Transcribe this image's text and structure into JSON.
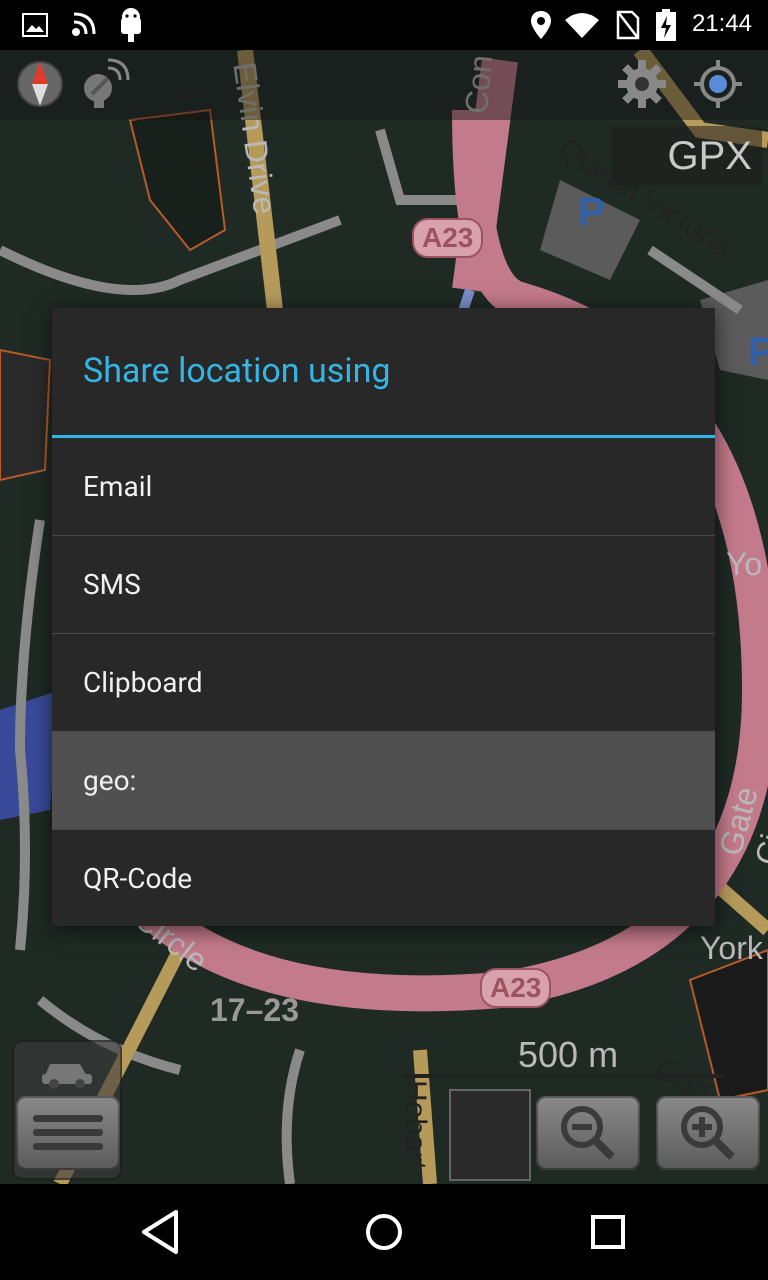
{
  "status_bar": {
    "time": "21:44",
    "icons": [
      "image-icon",
      "signal-wave-icon",
      "android-icon",
      "location-pin-icon",
      "wifi-icon",
      "no-sim-icon",
      "battery-charging-icon"
    ]
  },
  "map": {
    "labels": {
      "elvin_drive": "Elvin Drive",
      "queen_victoria": "Queen Victoria",
      "a23_top": "A23",
      "a23_bottom": "A23",
      "con": "Con",
      "york_1": "Yo",
      "york_2": "York",
      "gate_circle": "Gate Circle",
      "hobart": "Hobart",
      "cant": "Can",
      "circle": "Circle",
      "num": "17–23",
      "parking_1": "P",
      "parking_2": "P"
    },
    "scale": "500 m",
    "gpx_label": "GPX",
    "toolbar_icons": [
      "compass-icon",
      "gps-satellite-icon",
      "settings-gear-icon",
      "my-location-icon"
    ],
    "bottom_icons": [
      "car-icon",
      "menu-icon",
      "zoom-out-icon",
      "zoom-in-icon"
    ]
  },
  "dialog": {
    "title": "Share location using",
    "options": [
      {
        "label": "Email"
      },
      {
        "label": "SMS"
      },
      {
        "label": "Clipboard"
      },
      {
        "label": "geo:",
        "selected": true
      },
      {
        "label": "QR-Code"
      }
    ]
  },
  "colors": {
    "accent": "#33b5e5",
    "dialog_bg": "#282828",
    "selected_bg": "#505050"
  },
  "nav_bar": {
    "icons": [
      "back-icon",
      "home-icon",
      "recents-icon"
    ]
  }
}
